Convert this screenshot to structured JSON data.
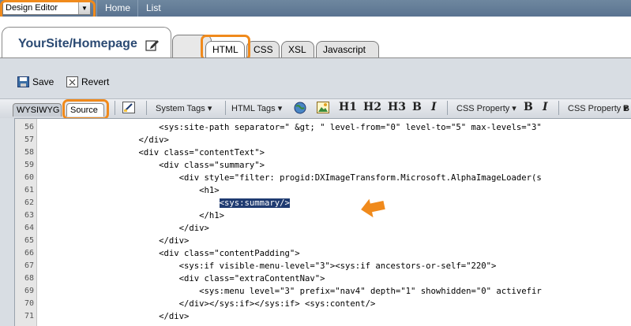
{
  "topbar": {
    "mode_select": "Design Editor",
    "nav": [
      "Home",
      "List"
    ]
  },
  "page_tab": {
    "title": "YourSite/Homepage"
  },
  "subtabs": [
    "HTML",
    "CSS",
    "XSL",
    "Javascript"
  ],
  "toolbar": {
    "save_label": "Save",
    "revert_label": "Revert"
  },
  "editor_toolbar": {
    "mode_tabs": [
      "WYSIWYG",
      "Source"
    ],
    "system_tags": "System Tags",
    "html_tags": "HTML Tags",
    "h1": "H1",
    "h2": "H2",
    "h3": "H3",
    "bold": "B",
    "italic": "I",
    "css_property_1": "CSS Property",
    "bold2": "B",
    "italic2": "I",
    "css_property_2": "CSS Property"
  },
  "code_lines": [
    {
      "n": "56",
      "text": "                        <sys:site-path separator=\" &gt; \" level-from=\"0\" level-to=\"5\" max-levels=\"3\""
    },
    {
      "n": "57",
      "text": "                    </div>"
    },
    {
      "n": "58",
      "text": "                    <div class=\"contentText\">"
    },
    {
      "n": "59",
      "text": "                        <div class=\"summary\">"
    },
    {
      "n": "60",
      "text": "                            <div style=\"filter: progid:DXImageTransform.Microsoft.AlphaImageLoader(s"
    },
    {
      "n": "61",
      "text": "                                <h1>"
    },
    {
      "n": "62",
      "text": "                                    ",
      "highlight": "<sys:summary/>"
    },
    {
      "n": "63",
      "text": "                                </h1>"
    },
    {
      "n": "64",
      "text": "                            </div>"
    },
    {
      "n": "65",
      "text": "                        </div>"
    },
    {
      "n": "66",
      "text": "                        <div class=\"contentPadding\">"
    },
    {
      "n": "67",
      "text": "                            <sys:if visible-menu-level=\"3\"><sys:if ancestors-or-self=\"220\">"
    },
    {
      "n": "68",
      "text": "                            <div class=\"extraContentNav\">"
    },
    {
      "n": "69",
      "text": "                                <sys:menu level=\"3\" prefix=\"nav4\" depth=\"1\" showhidden=\"0\" activefir"
    },
    {
      "n": "70",
      "text": "                            </div></sys:if></sys:if> <sys:content/>"
    },
    {
      "n": "71",
      "text": "                        </div>"
    }
  ],
  "colors": {
    "highlight_ring": "#f08a1c",
    "topbar": "#5a7390",
    "selection": "#1f3b71"
  }
}
